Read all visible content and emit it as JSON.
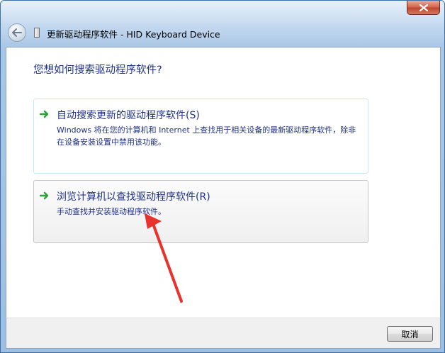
{
  "window": {
    "title": "更新驱动程序软件 - HID Keyboard Device",
    "close_icon": "close-icon",
    "back_icon": "back-arrow-icon"
  },
  "main": {
    "question": "您想如何搜索驱动程序软件?",
    "options": [
      {
        "title": "自动搜索更新的驱动程序软件(S)",
        "description": "Windows 将在您的计算机和 Internet 上查找用于相关设备的最新驱动程序软件，除非在设备安装设置中禁用该功能。",
        "icon": "green-arrow-icon"
      },
      {
        "title": "浏览计算机以查找驱动程序软件(R)",
        "description": "手动查找并安装驱动程序软件。",
        "icon": "green-arrow-icon"
      }
    ]
  },
  "footer": {
    "cancel_label": "取消"
  },
  "colors": {
    "link_blue": "#1e3287",
    "annotation_red": "#e8322b",
    "close_red": "#c0452f"
  }
}
